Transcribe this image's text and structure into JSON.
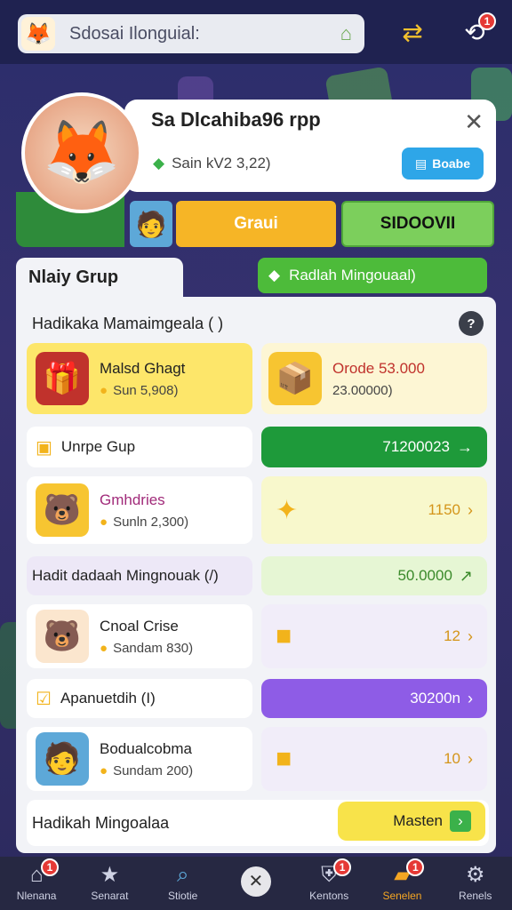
{
  "topbar": {
    "search_text": "Sdosai Ilonguial:",
    "badge_count": "1"
  },
  "profile": {
    "name": "Sa Dlcahiba96 rpp",
    "status": "Sain kV2 3,22)",
    "button_label": "Boabe",
    "action_yellow": "Graui",
    "action_green": "SIDOOVII"
  },
  "tabs": {
    "active": "Nlaiy Grup",
    "right": "Radlah Mingouaal)"
  },
  "panel": {
    "section_title": "Hadikaka Mamaimgeala ( )",
    "help": "?",
    "featured": {
      "left_title": "Malsd Ghagt",
      "left_sub": "Sun 5,908)",
      "right_title": "Orode 53.000",
      "right_sub": "23.00000)"
    },
    "rows": [
      {
        "left_title": "Unrpe Gup",
        "right_value": "71200023"
      },
      {
        "left_title": "Gmhdries",
        "left_sub": "Sunln 2,300)",
        "right_value": "1150"
      },
      {
        "left_title": "Hadit dadaah Mingnouak (/)",
        "right_value": "50.0000"
      },
      {
        "left_title": "Cnoal Crise",
        "left_sub": "Sandam 830)",
        "right_value": "12"
      },
      {
        "left_title": "Apanuetdih (I)",
        "right_value": "30200n"
      },
      {
        "left_title": "Bodualcobma",
        "left_sub": "Sundam 200)",
        "right_value": "10"
      }
    ],
    "footer_left": "Hadikah Mingoalaa",
    "footer_button": "Masten"
  },
  "nav": [
    {
      "icon": "home-icon",
      "label": "Nlenana",
      "badge": "1"
    },
    {
      "icon": "star-icon",
      "label": "Senarat"
    },
    {
      "icon": "search-icon",
      "label": "Stiotie"
    },
    {
      "icon": "close-circle-icon",
      "label": ""
    },
    {
      "icon": "shield-icon",
      "label": "Kentons",
      "badge": "1"
    },
    {
      "icon": "folder-icon",
      "label": "Senelen",
      "badge": "1"
    },
    {
      "icon": "gear-icon",
      "label": "Renels"
    }
  ],
  "colors": {
    "accent_green": "#4dbb3a",
    "accent_yellow": "#f6b526",
    "accent_purple": "#8e5ce6",
    "dark_green": "#1e9a3a",
    "nav_active": "#f5a623"
  }
}
